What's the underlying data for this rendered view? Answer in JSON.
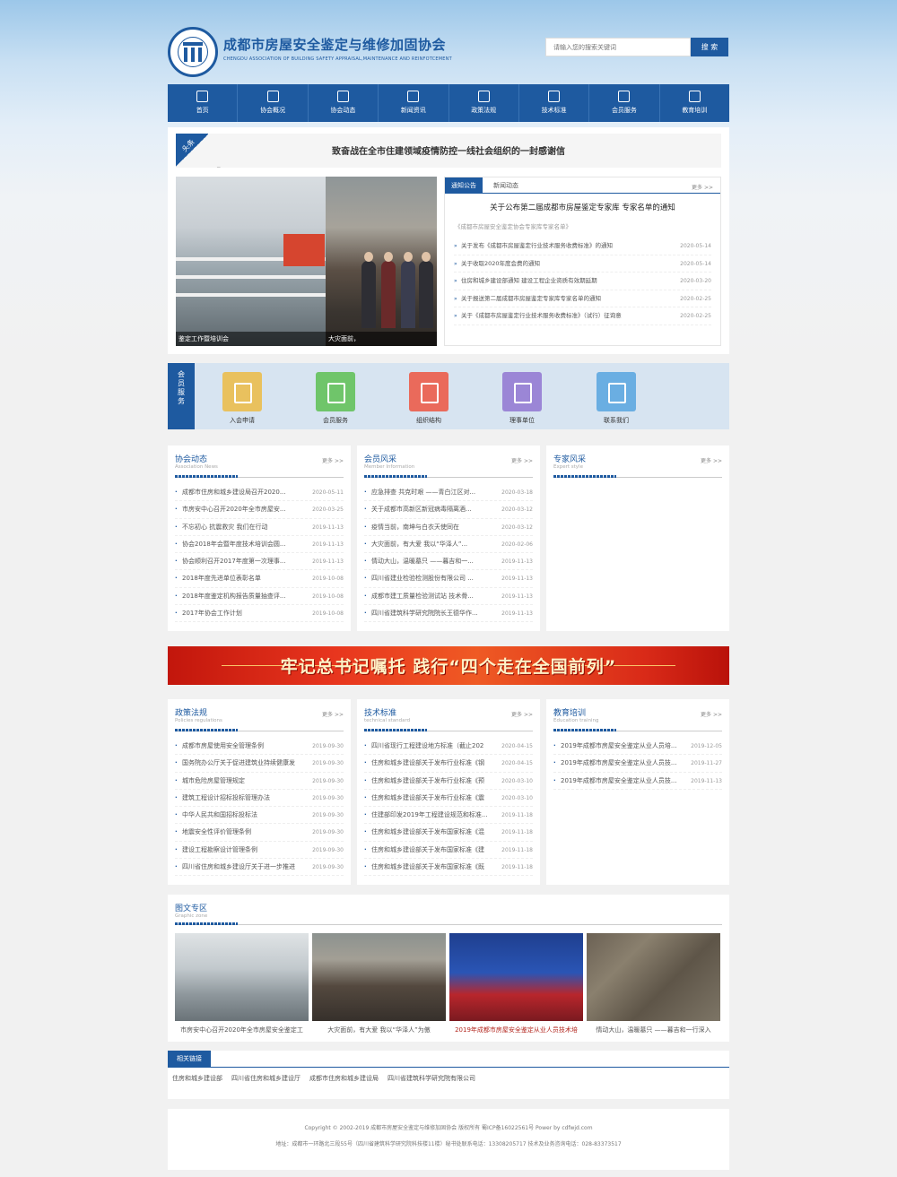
{
  "site": {
    "title_cn": "成都市房屋安全鉴定与维修加固协会",
    "title_en": "CHENGDU ASSOCIATION OF BUILDING SAFETY APPRAISAL,MAINTENANCE AND REINFOTCEMENT",
    "logo_text": "CABSAMR"
  },
  "search": {
    "placeholder": "请输入您的搜索关键词",
    "button": "搜 索"
  },
  "nav": [
    {
      "label": "首页",
      "icon": "home-icon"
    },
    {
      "label": "协会概况",
      "icon": "overview-icon"
    },
    {
      "label": "协会动态",
      "icon": "news-icon"
    },
    {
      "label": "新闻资讯",
      "icon": "document-icon"
    },
    {
      "label": "政策法规",
      "icon": "policy-icon"
    },
    {
      "label": "技术标准",
      "icon": "standard-icon"
    },
    {
      "label": "会员服务",
      "icon": "members-icon"
    },
    {
      "label": "教育培训",
      "icon": "education-icon"
    }
  ],
  "headline": {
    "tag": "头条",
    "title": "致奋战在全市住建领域疫情防控一线社会组织的一封感谢信",
    "under": "_"
  },
  "photos": [
    {
      "caption": "鉴定工作暨培训会"
    },
    {
      "caption": "大灾面前，"
    }
  ],
  "notice": {
    "tab_active": "通知公告",
    "tab_other": "新闻动态",
    "more": "更多 >>",
    "title": "关于公布第二届成都市房屋鉴定专家库 专家名单的通知",
    "subtitle": "《成都市房屋安全鉴定协会专家库专家名单》",
    "items": [
      {
        "text": "关于发布《成都市房屋鉴定行业技术服务收费标准》的通知",
        "date": "2020-05-14"
      },
      {
        "text": "关于收取2020年度会费的通知",
        "date": "2020-05-14"
      },
      {
        "text": "住房和城乡建设部通知 建设工程企业资质有效期延期",
        "date": "2020-03-20"
      },
      {
        "text": "关于报送第二届成都市房屋鉴定专家库专家名单的通知",
        "date": "2020-02-25"
      },
      {
        "text": "关于《成都市房屋鉴定行业技术服务收费标准》（试行）征询意",
        "date": "2020-02-25"
      }
    ]
  },
  "member_services": {
    "tag": "会员服务",
    "items": [
      {
        "label": "入会申请",
        "color": "#e9c15e",
        "icon": "application-icon"
      },
      {
        "label": "会员服务",
        "color": "#6fc56a",
        "icon": "share-icon"
      },
      {
        "label": "组织结构",
        "color": "#ea6a5b",
        "icon": "org-chart-icon"
      },
      {
        "label": "理事单位",
        "color": "#9b86d6",
        "icon": "files-icon"
      },
      {
        "label": "联系我们",
        "color": "#6aaee2",
        "icon": "contact-icon"
      }
    ]
  },
  "columns1": [
    {
      "title": "协会动态",
      "en": "Association News",
      "more": "更多 >>",
      "items": [
        {
          "text": "成都市住房和城乡建设局召开2020...",
          "date": "2020-05-11"
        },
        {
          "text": "市房安中心召开2020年全市房屋安...",
          "date": "2020-03-25"
        },
        {
          "text": "不忘初心 抗震救灾 我们在行动",
          "date": "2019-11-13"
        },
        {
          "text": "协会2018年会暨年度技术培训会圆...",
          "date": "2019-11-13"
        },
        {
          "text": "协会顺利召开2017年度第一次理事...",
          "date": "2019-11-13"
        },
        {
          "text": "2018年度先进单位表彰名单",
          "date": "2019-10-08"
        },
        {
          "text": "2018年度鉴定机构报告质量抽查评...",
          "date": "2019-10-08"
        },
        {
          "text": "2017年协会工作计划",
          "date": "2019-10-08"
        }
      ]
    },
    {
      "title": "会员风采",
      "en": "Member Information",
      "more": "更多 >>",
      "items": [
        {
          "text": "应急排查 共克时艰 ——青白江区对...",
          "date": "2020-03-18"
        },
        {
          "text": "关于成都市高新区新冠病毒隔离酒...",
          "date": "2020-03-12"
        },
        {
          "text": "疫情当前，南坤与白衣天使同在",
          "date": "2020-03-12"
        },
        {
          "text": "大灾面前，有大爱 我以“华泽人”...",
          "date": "2020-02-06"
        },
        {
          "text": "情动大山，温暖墓只 ——暮吉和一...",
          "date": "2019-11-13"
        },
        {
          "text": "四川省建业检验检测股份有限公司 ...",
          "date": "2019-11-13"
        },
        {
          "text": "成都市建工质量检验测试站 技术骨...",
          "date": "2019-11-13"
        },
        {
          "text": "四川省建筑科学研究院院长王德华作...",
          "date": "2019-11-13"
        }
      ]
    },
    {
      "title": "专家风采",
      "en": "Expert style",
      "more": "更多 >>",
      "items": []
    }
  ],
  "banner": {
    "text": "牢记总书记嘱托 践行“四个走在全国前列”"
  },
  "columns2": [
    {
      "title": "政策法规",
      "en": "Policies regulations",
      "more": "更多 >>",
      "items": [
        {
          "text": "成都市房屋使用安全管理条例",
          "date": "2019-09-30"
        },
        {
          "text": "国务院办公厅关于促进建筑业持续健康发",
          "date": "2019-09-30"
        },
        {
          "text": "城市危险房屋管理规定",
          "date": "2019-09-30"
        },
        {
          "text": "建筑工程设计招标投标管理办法",
          "date": "2019-09-30"
        },
        {
          "text": "中华人民共和国招标投标法",
          "date": "2019-09-30"
        },
        {
          "text": "地震安全性评价管理条例",
          "date": "2019-09-30"
        },
        {
          "text": "建设工程勘察设计管理条例",
          "date": "2019-09-30"
        },
        {
          "text": "四川省住房和城乡建设厅关于进一步推进",
          "date": "2019-09-30"
        }
      ]
    },
    {
      "title": "技术标准",
      "en": "technical standard",
      "more": "更多 >>",
      "items": [
        {
          "text": "四川省现行工程建设地方标准（截止202",
          "date": "2020-04-15"
        },
        {
          "text": "住房和城乡建设部关于发布行业标准《钢",
          "date": "2020-04-15"
        },
        {
          "text": "住房和城乡建设部关于发布行业标准《预",
          "date": "2020-03-10"
        },
        {
          "text": "住房和城乡建设部关于发布行业标准《震",
          "date": "2020-03-10"
        },
        {
          "text": "住建部印发2019年工程建设规范和标准...",
          "date": "2019-11-18"
        },
        {
          "text": "住房和城乡建设部关于发布国家标准《混",
          "date": "2019-11-18"
        },
        {
          "text": "住房和城乡建设部关于发布国家标准《建",
          "date": "2019-11-18"
        },
        {
          "text": "住房和城乡建设部关于发布国家标准《既",
          "date": "2019-11-18"
        }
      ]
    },
    {
      "title": "教育培训",
      "en": "Education training",
      "more": "更多 >>",
      "items": [
        {
          "text": "2019年成都市房屋安全鉴定从业人员培...",
          "date": "2019-12-05"
        },
        {
          "text": "2019年成都市房屋安全鉴定从业人员技...",
          "date": "2019-11-27"
        },
        {
          "text": "2019年成都市房屋安全鉴定从业人员技...",
          "date": "2019-11-13"
        }
      ]
    }
  ],
  "gallery": {
    "title": "图文专区",
    "en": "Graphic zone",
    "items": [
      {
        "caption": "市房安中心召开2020年全市房屋安全鉴定工"
      },
      {
        "caption": "大灾面前，有大爱 我以“华泽人”为傲"
      },
      {
        "caption": "2019年成都市房屋安全鉴定从业人员技术培"
      },
      {
        "caption": "情动大山，温暖墓只 ——暮吉和一行深入"
      }
    ]
  },
  "links": {
    "tab": "相关链接",
    "items": [
      "住房和城乡建设部",
      "四川省住房和城乡建设厅",
      "成都市住房和城乡建设局",
      "四川省建筑科学研究院有限公司"
    ]
  },
  "footer": {
    "line1": "Copyright © 2002-2019 成都市房屋安全鉴定与维修加固协会 版权所有 蜀ICP备16022561号 Power by cdfwjd.com",
    "line2": "地址：成都市一环路北三段55号（四川省建筑科学研究院科技楼11楼）秘书处联系电话：13308205717 技术及业务咨询电话：028-83373517"
  }
}
